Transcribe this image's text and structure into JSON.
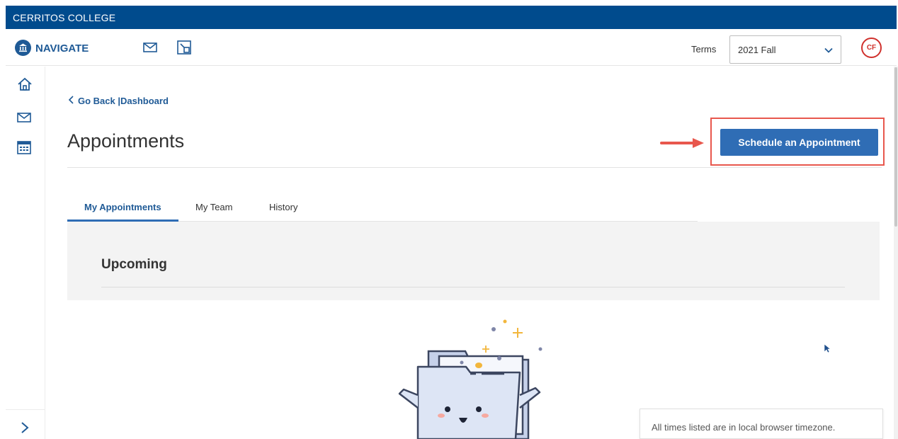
{
  "banner": {
    "college": "CERRITOS COLLEGE"
  },
  "header": {
    "logo_text": "NAVIGATE",
    "terms_label": "Terms",
    "term_selected": "2021 Fall",
    "avatar_initials": "CF"
  },
  "sidebar": {
    "items": [
      {
        "icon": "home-icon"
      },
      {
        "icon": "mail-icon"
      },
      {
        "icon": "calendar-icon"
      }
    ],
    "expand_icon": "chevron-right-icon"
  },
  "main": {
    "go_back": "Go Back |Dashboard",
    "title": "Appointments",
    "schedule_button": "Schedule an Appointment",
    "tabs": [
      {
        "label": "My Appointments",
        "active": true
      },
      {
        "label": "My Team",
        "active": false
      },
      {
        "label": "History",
        "active": false
      }
    ],
    "upcoming_title": "Upcoming",
    "timezone_note": "All times listed are in local browser timezone."
  },
  "colors": {
    "banner": "#004b8d",
    "primary": "#2f6db5",
    "highlight": "#e8574d",
    "avatar": "#d0312d"
  }
}
